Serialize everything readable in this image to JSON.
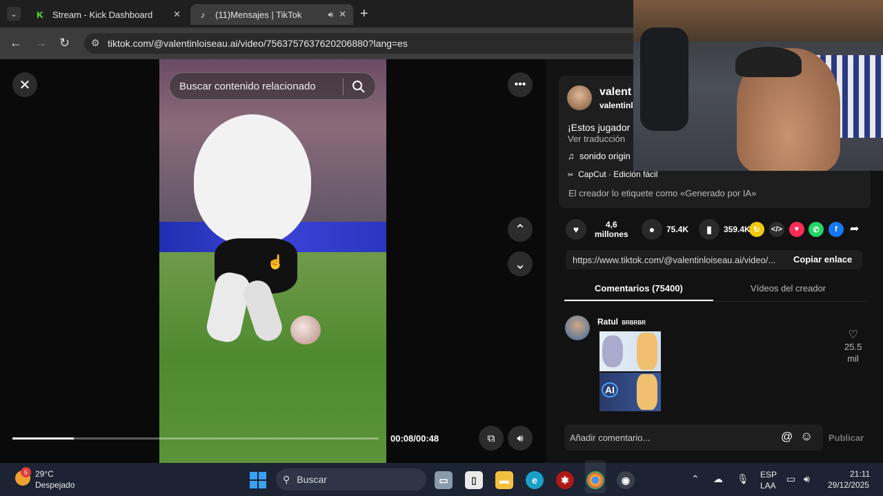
{
  "browser": {
    "tabs": [
      {
        "title": "Stream - Kick Dashboard",
        "favicon": "K"
      },
      {
        "title": "(11)Mensajes | TikTok",
        "favicon": "♪"
      }
    ],
    "new_tab": "+",
    "url": "tiktok.com/@valentinloiseau.ai/video/7563757637620206880?lang=es"
  },
  "player": {
    "search_placeholder": "Buscar contenido relacionado",
    "current_time": "00:08/00:48",
    "progress": 0.167
  },
  "post": {
    "author_name": "valent",
    "author_handle": "valentinl",
    "caption": "¡Estos jugador",
    "translate": "Ver traducción",
    "sound": "sonido origin",
    "capcut": "CapCut · Edición fácil",
    "ai_label": "El creador lo etiquete como «Generado por IA»"
  },
  "actions": {
    "likes_line1": "4,6",
    "likes_line2": "millones",
    "comments": "75.4K",
    "saves": "359.4K"
  },
  "link": {
    "url": "https://www.tiktok.com/@valentinloiseau.ai/video/...",
    "copy_label": "Copiar enlace"
  },
  "tabs": {
    "comments": "Comentarios (75400)",
    "creator_videos": "Vídeos del creador"
  },
  "comment": {
    "user": "Ratul",
    "badge": "BRBRBR",
    "likes_line1": "25.5",
    "likes_line2": "mil",
    "sticker_text": "AI"
  },
  "comment_box": {
    "placeholder": "Añadir comentario...",
    "publish": "Publicar"
  },
  "taskbar": {
    "weather_temp": "29°C",
    "weather_desc": "Despejado",
    "weather_badge": "5",
    "search": "Buscar",
    "lang_line1": "ESP",
    "lang_line2": "LAA",
    "time": "21:11",
    "date": "29/12/2025"
  }
}
